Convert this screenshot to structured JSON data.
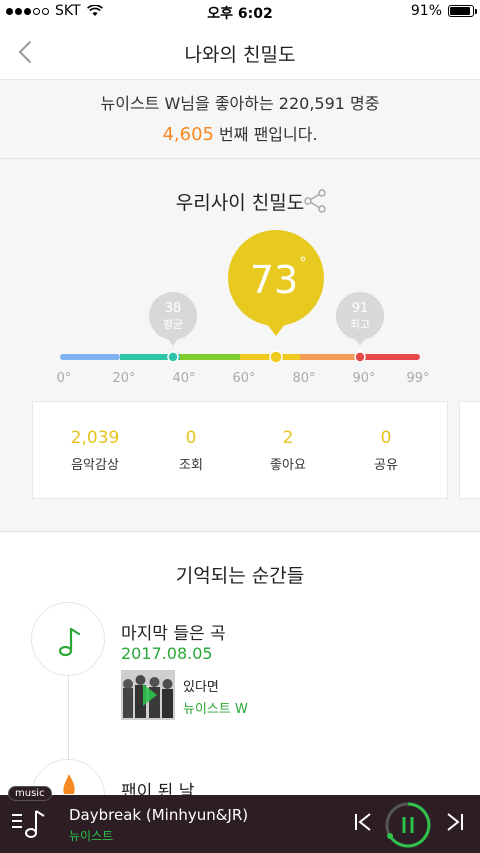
{
  "status": {
    "carrier": "SKT",
    "time": "오후 6:02",
    "battery": "91%",
    "battery_level": 0.91
  },
  "nav": {
    "title": "나와의 친밀도"
  },
  "fan": {
    "line1": "뉴이스트 W님을 좋아하는 220,591 명중",
    "rank": "4,605",
    "rank_suffix": " 번째 팬입니다."
  },
  "intimacy": {
    "title": "우리사이 친밀도",
    "score": "73",
    "degree": "°",
    "avg_value": "38",
    "avg_label": "평균",
    "max_value": "91",
    "max_label": "최고",
    "ticks": [
      "0°",
      "20°",
      "40°",
      "60°",
      "80°",
      "90°",
      "99°"
    ]
  },
  "stats": [
    {
      "value": "2,039",
      "label": "음악감상"
    },
    {
      "value": "0",
      "label": "조회"
    },
    {
      "value": "2",
      "label": "좋아요"
    },
    {
      "value": "0",
      "label": "공유"
    }
  ],
  "memories": {
    "title": "기억되는 순간들",
    "item1": {
      "title": "마지막 들은 곡",
      "date": "2017.08.05",
      "song": "있다면",
      "artist": "뉴이스트 W"
    },
    "item2": {
      "title": "팬이 된 날"
    }
  },
  "player": {
    "tag": "music",
    "title": "Daybreak (Minhyun&JR)",
    "artist": "뉴이스트"
  },
  "colors": {
    "accent_yellow": "#e8c91f",
    "green": "#2aa836",
    "orange": "#f5891f"
  },
  "icons": {
    "back": "back-chevron-icon",
    "share": "share-icon",
    "note": "music-note-icon",
    "flame": "flame-icon"
  }
}
